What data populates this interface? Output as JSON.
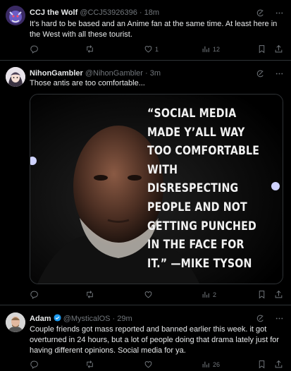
{
  "tweets": [
    {
      "name": "CCJ the Wolf",
      "handle": "@CCJ53926396 · 18m",
      "text": "It's hard to be based and an Anime fan at the same time.  At least here in the West with all these tourist.",
      "stats": {
        "replies": "",
        "reposts": "",
        "likes": "1",
        "views": "12"
      },
      "avatar_icon": "wolf-avatar-icon"
    },
    {
      "name": "NihonGambler",
      "handle": "@NihonGambler · 3m",
      "text": "Those antis are too comfortable...",
      "image_quote": "“SOCIAL MEDIA MADE Y’ALL WAY TOO COMFORTABLE WITH DISRESPECTING PEOPLE AND NOT GETTING PUNCHED IN THE FACE FOR IT.” —MIKE TYSON",
      "stats": {
        "replies": "",
        "reposts": "",
        "likes": "",
        "views": "2"
      },
      "avatar_icon": "anime-girl-avatar-icon"
    },
    {
      "name": "Adam",
      "handle": "@MysticalOS · 29m",
      "text": "Couple friends got mass reported and banned earlier this week. it got overturned in 24 hours, but a lot of people doing that drama lately just for having different opinions. Social media for ya.",
      "stats": {
        "replies": "",
        "reposts": "",
        "likes": "",
        "views": "26"
      },
      "avatar_icon": "man-avatar-icon"
    }
  ],
  "colors": {
    "background": "#000000",
    "text": "#e7e9ea",
    "muted": "#71767b",
    "border": "#2f3336",
    "verified": "#1d9bf0"
  }
}
